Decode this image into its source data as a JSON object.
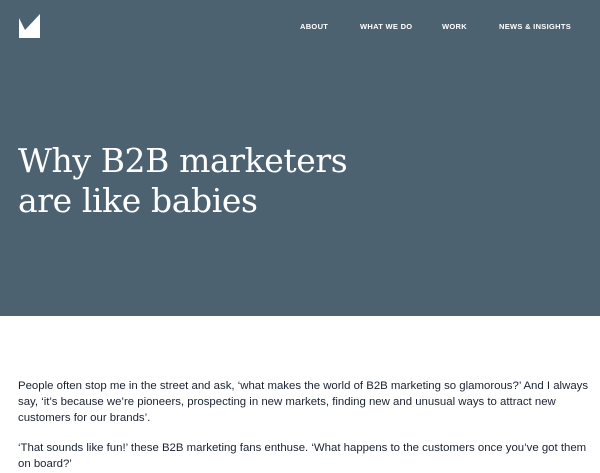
{
  "header": {
    "logo_icon": "checkmark-logo-icon",
    "nav": {
      "about": "ABOUT",
      "what_we_do": "WHAT WE DO",
      "work": "WORK",
      "news": "NEWS & INSIGHTS"
    }
  },
  "hero": {
    "background_color": "#4d6271",
    "title_line1": "Why B2B marketers",
    "title_line2": "are like babies"
  },
  "article": {
    "paragraphs": [
      "People often stop me in the street and ask, ‘what makes the world of B2B marketing so glamorous?’ And I always say, ‘it’s because we’re pioneers, prospecting in new markets, finding new and unusual ways to attract new customers for our brands’.",
      "‘That sounds like fun!’ these B2B marketing fans enthuse. ‘What happens to the customers once you’ve got them on board?’"
    ]
  }
}
